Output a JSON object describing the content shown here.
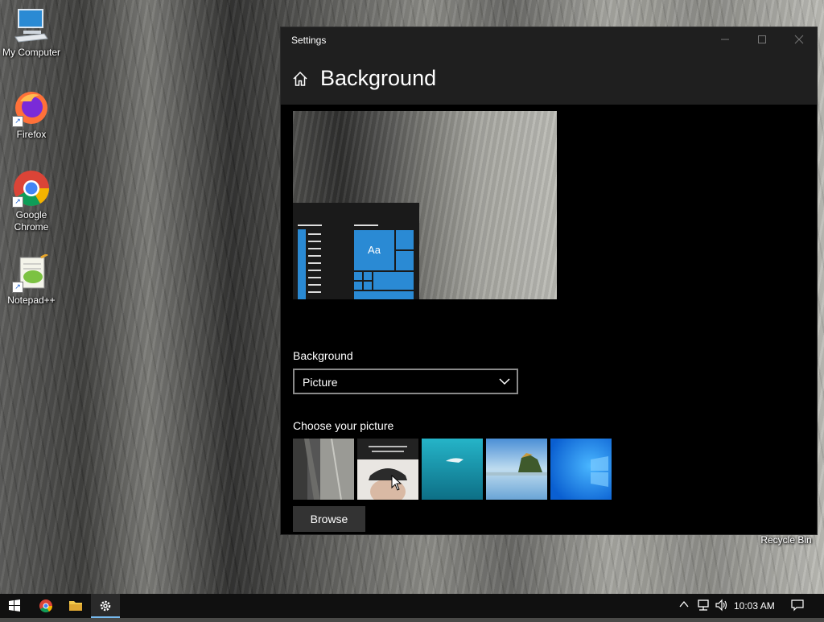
{
  "desktop": {
    "icons": [
      {
        "label": "My Computer"
      },
      {
        "label": "Firefox"
      },
      {
        "label": "Google Chrome"
      },
      {
        "label": "Notepad++"
      }
    ],
    "recycle_bin_label": "Recycle Bin"
  },
  "window": {
    "title": "Settings",
    "page_title": "Background",
    "preview_sample_text": "Aa",
    "background_label": "Background",
    "background_value": "Picture",
    "choose_label": "Choose your picture",
    "thumbnails": [
      "cliff",
      "person-photo",
      "underwater",
      "beach-rocks",
      "windows-blue"
    ],
    "browse_label": "Browse"
  },
  "taskbar": {
    "clock": "10:03 AM",
    "pinned": [
      "windows-start",
      "chrome",
      "file-explorer",
      "settings"
    ]
  },
  "colors": {
    "accent": "#2a8ad4",
    "window_bg": "#000000",
    "header_bg": "#1f1f1f",
    "taskbar_bg": "#101010"
  }
}
